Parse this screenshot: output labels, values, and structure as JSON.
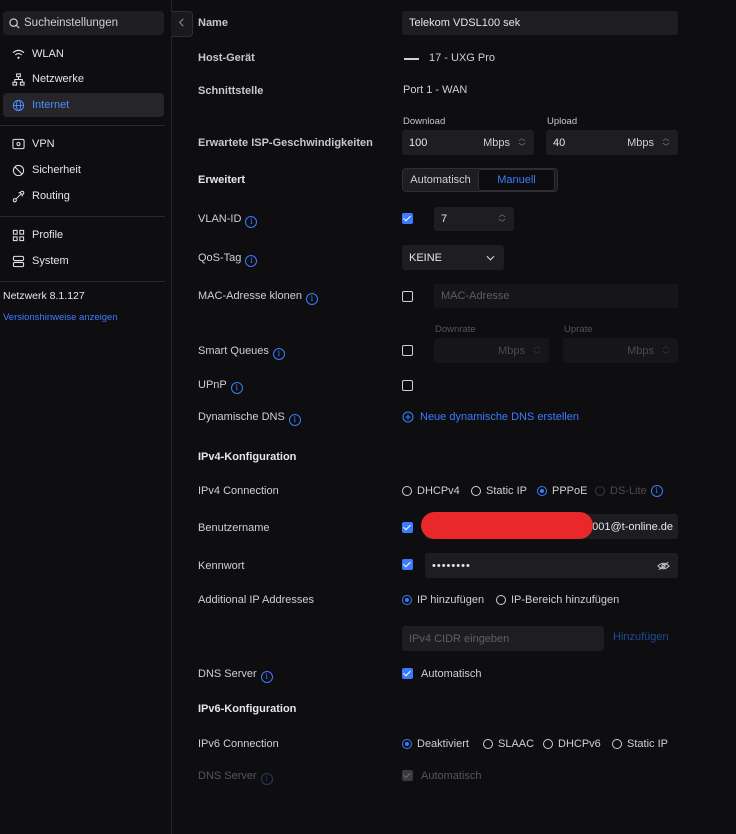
{
  "sidebar": {
    "search_placeholder": "Sucheinstellungen",
    "items": [
      {
        "label": "WLAN"
      },
      {
        "label": "Netzwerke"
      },
      {
        "label": "Internet"
      },
      {
        "label": "VPN"
      },
      {
        "label": "Sicherheit"
      },
      {
        "label": "Routing"
      },
      {
        "label": "Profile"
      },
      {
        "label": "System"
      }
    ],
    "active_item": "Internet",
    "version": "Netzwerk 8.1.127",
    "release_notes_link": "Versionshinweise anzeigen"
  },
  "form": {
    "name": {
      "label": "Name",
      "value": "Telekom VDSL100 sek"
    },
    "host_device": {
      "label": "Host-Gerät",
      "value": "17 - UXG Pro"
    },
    "interface": {
      "label": "Schnittstelle",
      "value": "Port 1 - WAN"
    },
    "isp_speed": {
      "label": "Erwartete ISP-Geschwindigkeiten",
      "download_label": "Download",
      "download_value": "100",
      "download_unit": "Mbps",
      "upload_label": "Upload",
      "upload_value": "40",
      "upload_unit": "Mbps"
    },
    "advanced": {
      "label": "Erweitert",
      "options": [
        "Automatisch",
        "Manuell"
      ],
      "selected": "Manuell"
    },
    "vlan_id": {
      "label": "VLAN-ID",
      "enabled": true,
      "value": "7"
    },
    "qos_tag": {
      "label": "QoS-Tag",
      "value": "KEINE"
    },
    "mac_clone": {
      "label": "MAC-Adresse klonen",
      "enabled": false,
      "placeholder": "MAC-Adresse"
    },
    "smart_queues": {
      "label": "Smart Queues",
      "enabled": false,
      "downrate_label": "Downrate",
      "uprate_label": "Uprate",
      "unit": "Mbps"
    },
    "upnp": {
      "label": "UPnP",
      "enabled": false
    },
    "dynamic_dns": {
      "label": "Dynamische DNS",
      "action": "Neue dynamische DNS erstellen"
    },
    "ipv4": {
      "section_title": "IPv4-Konfiguration",
      "connection_label": "IPv4 Connection",
      "connection_options": [
        "DHCPv4",
        "Static IP",
        "PPPoE",
        "DS-Lite"
      ],
      "connection_selected": "PPPoE",
      "username_label": "Benutzername",
      "username_visible_suffix": "0001@t-online.de",
      "password_label": "Kennwort",
      "password_mask": "••••••••",
      "additional_ip_label": "Additional IP Addresses",
      "additional_ip_options": [
        "IP hinzufügen",
        "IP-Bereich hinzufügen"
      ],
      "additional_ip_selected": "IP hinzufügen",
      "cidr_placeholder": "IPv4 CIDR eingeben",
      "add_button": "Hinzufügen",
      "dns_label": "DNS Server",
      "dns_auto_label": "Automatisch",
      "dns_auto": true
    },
    "ipv6": {
      "section_title": "IPv6-Konfiguration",
      "connection_label": "IPv6 Connection",
      "connection_options": [
        "Deaktiviert",
        "SLAAC",
        "DHCPv6",
        "Static IP"
      ],
      "connection_selected": "Deaktiviert",
      "dns_label": "DNS Server",
      "dns_auto_label": "Automatisch",
      "dns_auto": true
    }
  },
  "colors": {
    "accent": "#3a7bff",
    "background": "#0e0e10",
    "field": "#1e1e22",
    "redaction": "#e8282a"
  }
}
